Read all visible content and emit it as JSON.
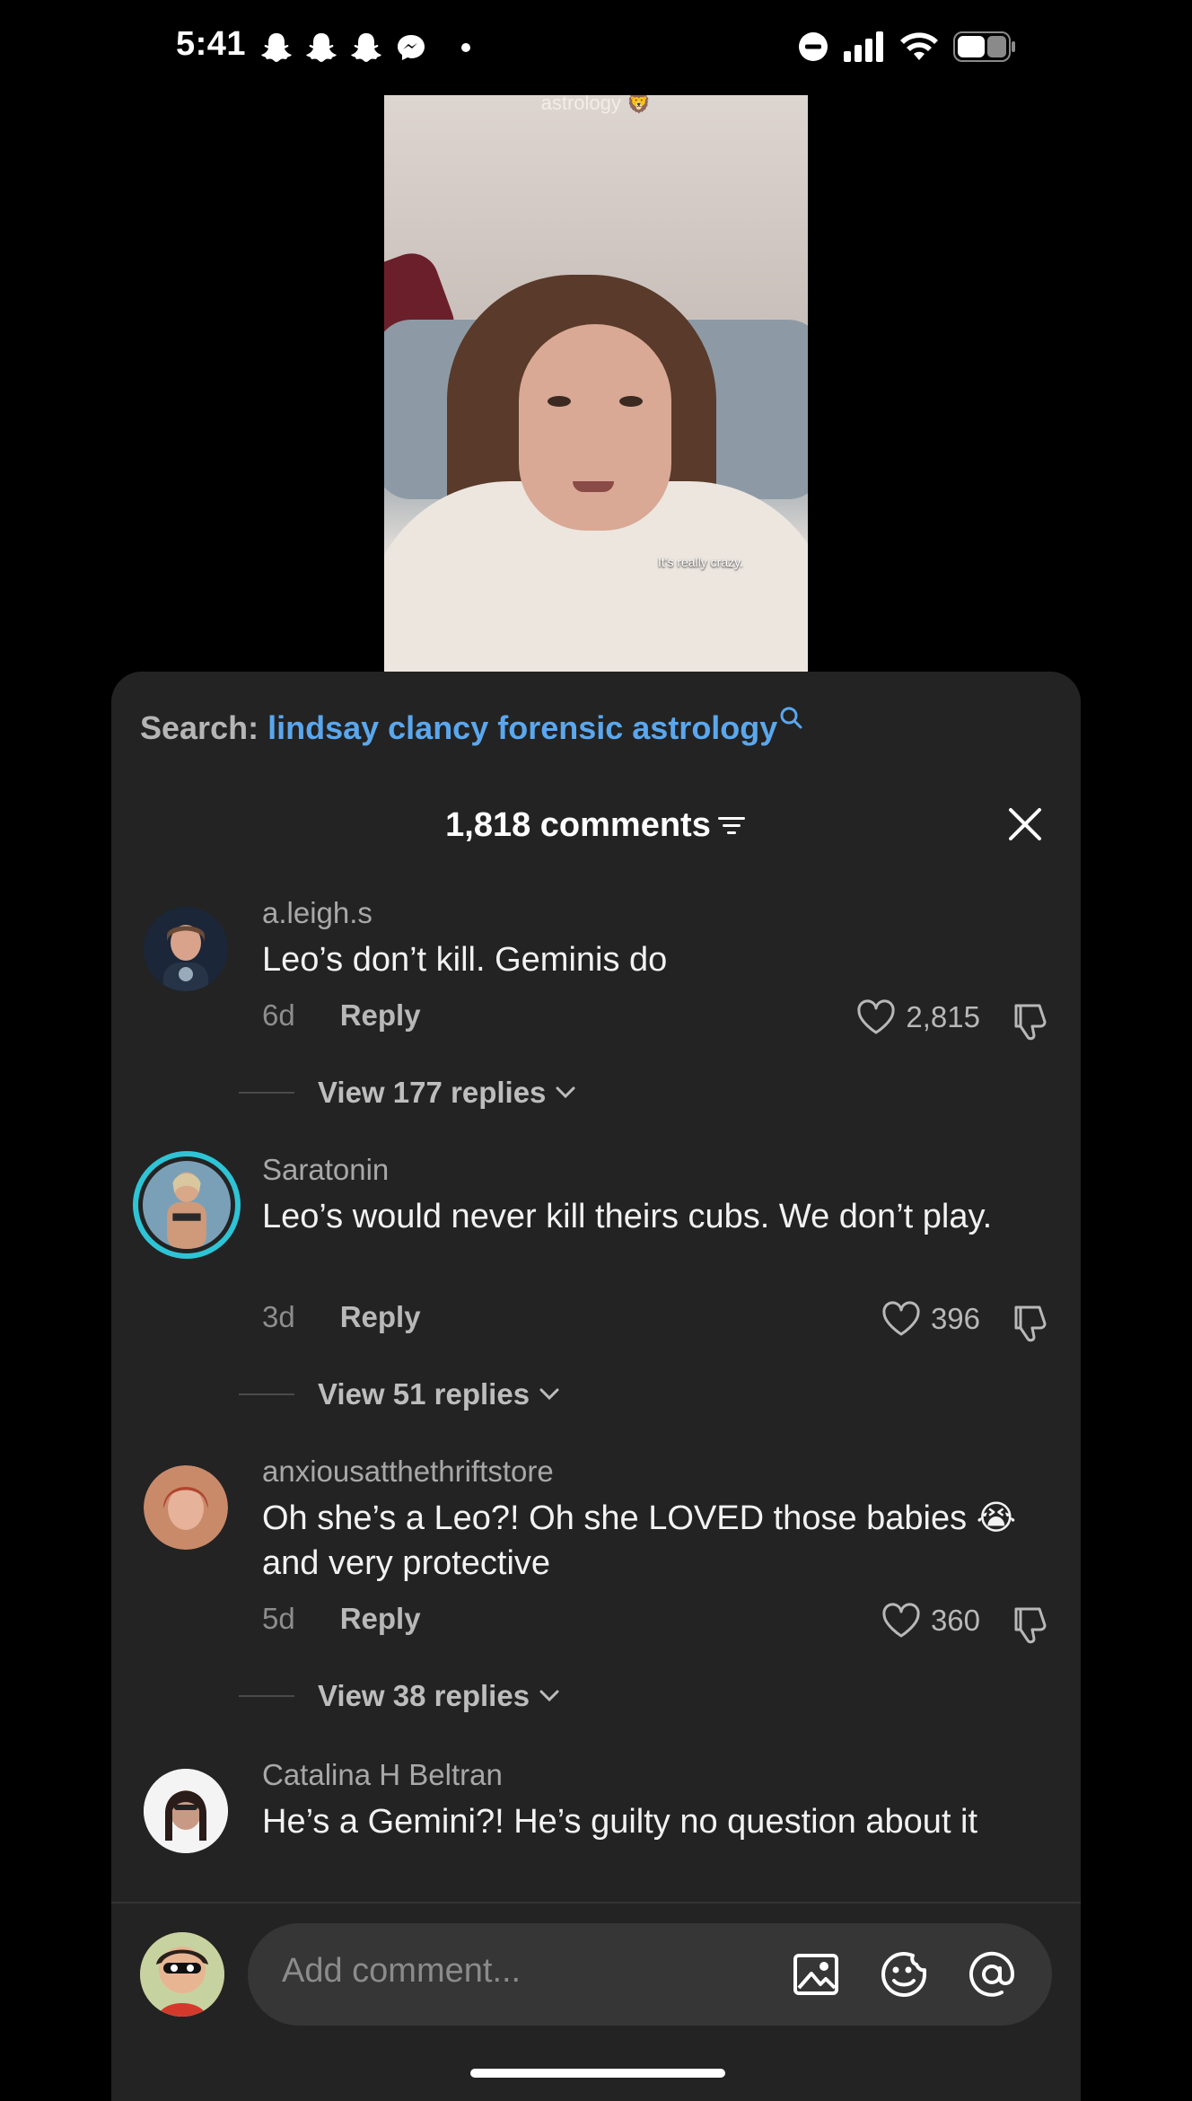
{
  "status_bar": {
    "time": "5:41",
    "notification_icons": [
      "snapchat-icon",
      "snapchat-icon",
      "snapchat-icon",
      "messenger-icon"
    ],
    "system_icons": [
      "do-not-disturb-icon",
      "cellular-signal-icon",
      "wifi-icon",
      "battery-icon"
    ]
  },
  "video": {
    "top_text": "astrology 🦁",
    "caption": "It's really crazy."
  },
  "search": {
    "label": "Search:",
    "query": "lindsay clancy forensic astrology"
  },
  "comments_header": {
    "count_label": "1,818 comments"
  },
  "comments": [
    {
      "username": "a.leigh.s",
      "text": "Leo’s don’t kill. Geminis do",
      "age": "6d",
      "reply_label": "Reply",
      "likes": "2,815",
      "view_replies": "View 177 replies"
    },
    {
      "username": "Saratonin",
      "text": "Leo’s would never kill theirs cubs. We don’t play.",
      "age": "3d",
      "reply_label": "Reply",
      "likes": "396",
      "view_replies": "View 51 replies"
    },
    {
      "username": "anxiousatthethriftstore",
      "text": "Oh she’s a Leo?! Oh she LOVED those babies 😭 and very protective",
      "age": "5d",
      "reply_label": "Reply",
      "likes": "360",
      "view_replies": "View 38 replies"
    },
    {
      "username": "Catalina H Beltran",
      "text": "He’s a Gemini?! He’s guilty no question about it"
    }
  ],
  "composer": {
    "placeholder": "Add comment..."
  },
  "colors": {
    "sheet_bg": "#232323",
    "link_blue": "#5aa7ee",
    "story_ring": "#2ec4d6"
  }
}
